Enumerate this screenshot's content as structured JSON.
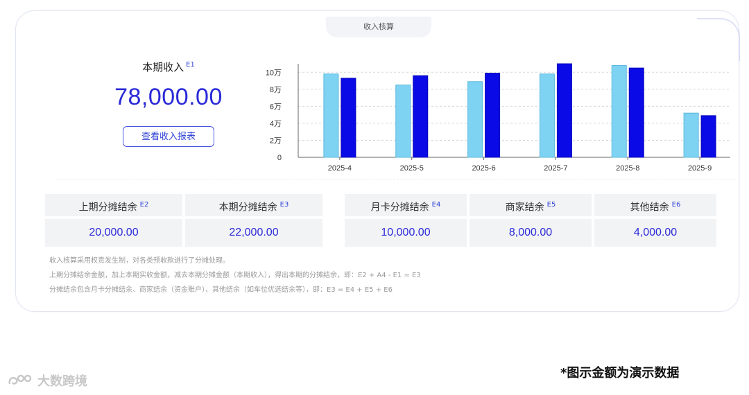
{
  "card_title": "收入核算",
  "summary": {
    "label": "本期收入",
    "label_tag": "E1",
    "amount": "78,000.00",
    "report_button": "查看收入报表"
  },
  "chart_data": {
    "type": "bar",
    "categories": [
      "2025-4",
      "2025-5",
      "2025-6",
      "2025-7",
      "2025-8",
      "2025-9"
    ],
    "series": [
      {
        "values": [
          98000,
          85000,
          89000,
          98000,
          108000,
          52000
        ],
        "color": "#7fd3f2"
      },
      {
        "values": [
          93000,
          96000,
          99000,
          110000,
          105000,
          49000
        ],
        "color": "#0a0ae6"
      }
    ],
    "ylim": [
      0,
      110000
    ],
    "y_ticks": [
      {
        "value": 0,
        "label": "0"
      },
      {
        "value": 20000,
        "label": "2万"
      },
      {
        "value": 40000,
        "label": "4万"
      },
      {
        "value": 60000,
        "label": "6万"
      },
      {
        "value": 80000,
        "label": "8万"
      },
      {
        "value": 100000,
        "label": "10万"
      }
    ],
    "grid": true
  },
  "balances": [
    {
      "label": "上期分摊结余",
      "tag": "E2",
      "value": "20,000.00"
    },
    {
      "label": "本期分摊结余",
      "tag": "E3",
      "value": "22,000.00"
    },
    {
      "label": "月卡分摊结余",
      "tag": "E4",
      "value": "10,000.00"
    },
    {
      "label": "商家结余",
      "tag": "E5",
      "value": "8,000.00"
    },
    {
      "label": "其他结余",
      "tag": "E6",
      "value": "4,000.00"
    }
  ],
  "notes": [
    "收入核算采用权责发生制，对各类预收款进行了分摊处理。",
    "上期分摊结余金额，加上本期实收金额，减去本期分摊金额（本期收入），得出本期的分摊结余，即：E2 + A4 - E1 = E3",
    "分摊结余包含月卡分摊结余、商家结余（资金账户）、其他结余（如车位优选结余等），即：E3 = E4 + E5 + E6"
  ],
  "footer_note": "*图示金额为演示数据",
  "watermark": "大数跨境"
}
